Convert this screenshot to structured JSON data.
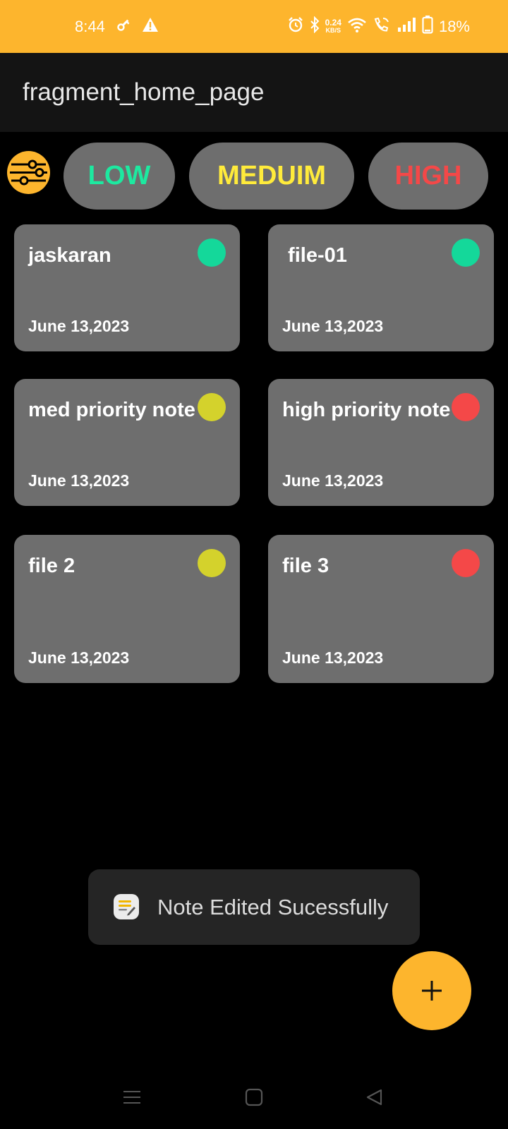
{
  "status_bar": {
    "time": "8:44",
    "net_speed_value": "0.24",
    "net_speed_unit": "KB/S",
    "battery": "18%",
    "icons": [
      "key-icon",
      "warning-icon",
      "alarm-icon",
      "bluetooth-icon",
      "wifi-icon",
      "wifi-call-icon",
      "signal-icon",
      "battery-icon"
    ]
  },
  "app_bar": {
    "title": "fragment_home_page"
  },
  "filters": {
    "icon": "filter-sliders-icon",
    "low_label": "LOW",
    "medium_label": "MEDUIM",
    "high_label": "HIGH",
    "colors": {
      "low": "#1DE9A0",
      "medium": "#FFEB3B",
      "high": "#F44848"
    }
  },
  "notes": [
    {
      "title": "jaskaran",
      "date": "June 13,2023",
      "priority": "low",
      "dot_color": "#14D89A"
    },
    {
      "title": " file-01",
      "date": "June 13,2023",
      "priority": "low",
      "dot_color": "#14D89A"
    },
    {
      "title": "med priority note",
      "date": "June 13,2023",
      "priority": "medium",
      "dot_color": "#D4D22C"
    },
    {
      "title": "high priority note",
      "date": "June 13,2023",
      "priority": "high",
      "dot_color": "#F44848"
    },
    {
      "title": "file 2",
      "date": "June 13,2023",
      "priority": "medium",
      "dot_color": "#D4D22C"
    },
    {
      "title": "file 3",
      "date": "June 13,2023",
      "priority": "high",
      "dot_color": "#F44848"
    }
  ],
  "toast": {
    "icon": "notes-app-icon",
    "message": "Note Edited Sucessfully"
  },
  "fab": {
    "icon": "plus-icon"
  },
  "nav_bar": {
    "icons": [
      "menu-icon",
      "home-square-icon",
      "back-triangle-icon"
    ]
  },
  "colors": {
    "accent": "#FDB52D",
    "card": "#6e6e6e",
    "background": "#000000",
    "app_bar": "#141414"
  }
}
